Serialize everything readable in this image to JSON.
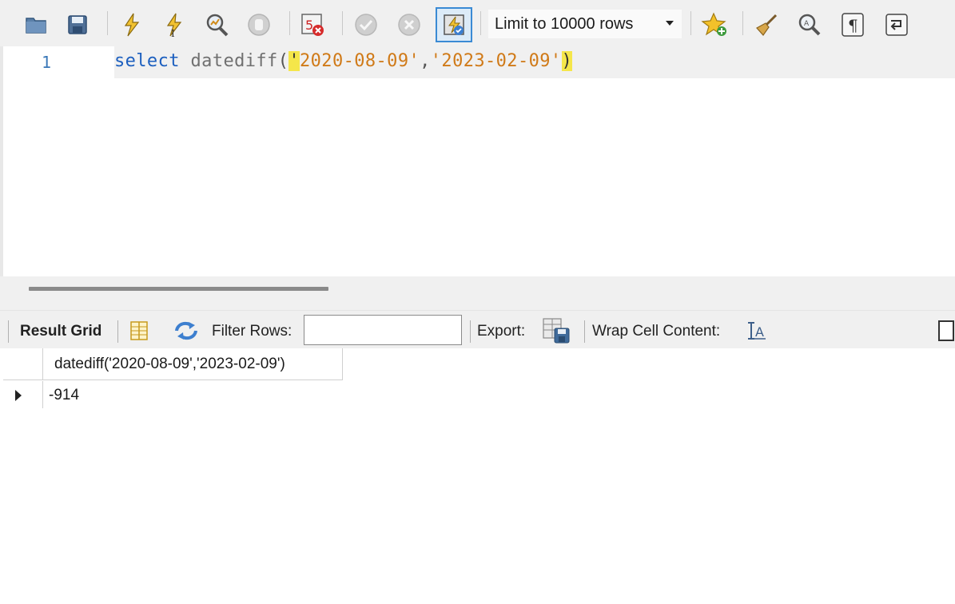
{
  "toolbar": {
    "buttons": [
      {
        "name": "open-file-icon"
      },
      {
        "name": "save-icon"
      },
      {
        "name": "execute-all-icon"
      },
      {
        "name": "execute-current-icon"
      },
      {
        "name": "explain-icon"
      },
      {
        "name": "stop-icon"
      },
      {
        "name": "toggle-continue-on-error-icon"
      },
      {
        "name": "commit-icon"
      },
      {
        "name": "rollback-icon"
      },
      {
        "name": "autocommit-icon"
      }
    ],
    "limit_label": "Limit to 10000 rows",
    "right_buttons": [
      {
        "name": "add-snippet-icon"
      },
      {
        "name": "beautify-icon"
      },
      {
        "name": "find-icon"
      },
      {
        "name": "invisible-chars-icon"
      },
      {
        "name": "word-wrap-icon"
      }
    ]
  },
  "editor": {
    "line_number": "1",
    "code": {
      "keyword": "select",
      "function": "datediff",
      "open_paren": "(",
      "quote_open": "'",
      "arg1": "2020-08-09'",
      "comma": ",",
      "arg2": "'2023-02-09'",
      "close_paren": ")"
    }
  },
  "result_toolbar": {
    "result_grid_label": "Result Grid",
    "filter_rows_label": "Filter Rows:",
    "filter_value": "",
    "export_label": "Export:",
    "wrap_label": "Wrap Cell Content:"
  },
  "grid": {
    "columns": [
      "datediff('2020-08-09','2023-02-09')"
    ],
    "rows": [
      [
        "-914"
      ]
    ]
  },
  "colors": {
    "keyword": "#1c5fbf",
    "string": "#d07a18",
    "bracket_highlight": "#f5e64a",
    "line_number": "#3a78b8"
  }
}
